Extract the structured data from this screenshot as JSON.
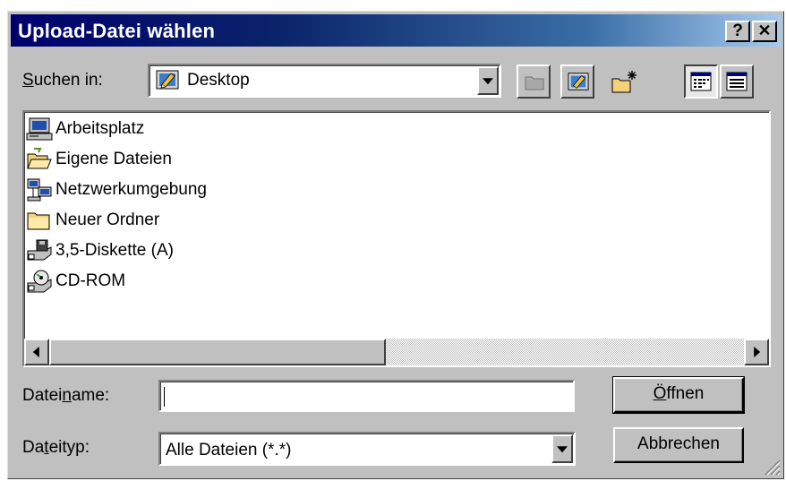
{
  "window": {
    "title": "Upload-Datei wählen",
    "help_glyph": "?",
    "close_glyph": "✕"
  },
  "lookin": {
    "label_pre": "",
    "label_u": "S",
    "label_post": "uchen in:",
    "value": "Desktop",
    "icon": "desktop-icon"
  },
  "toolbar": {
    "icons": [
      "up-one-level-icon",
      "desktop-icon",
      "new-folder-icon",
      "list-view-icon",
      "details-view-icon"
    ]
  },
  "files": [
    {
      "label": "Arbeitsplatz",
      "icon": "my-computer-icon"
    },
    {
      "label": "Eigene Dateien",
      "icon": "open-folder-icon"
    },
    {
      "label": "Netzwerkumgebung",
      "icon": "network-icon"
    },
    {
      "label": "Neuer Ordner",
      "icon": "folder-icon"
    },
    {
      "label": "3,5-Diskette (A)",
      "icon": "floppy-drive-icon"
    },
    {
      "label": "CD-ROM",
      "icon": "cd-drive-icon"
    }
  ],
  "filename": {
    "label_pre": "Datei",
    "label_u": "n",
    "label_post": "ame:",
    "value": ""
  },
  "filetype": {
    "label_pre": "Da",
    "label_u": "t",
    "label_post": "eityp:",
    "value": "Alle Dateien (*.*)"
  },
  "buttons": {
    "open_pre": "",
    "open_u": "Ö",
    "open_post": "ffnen",
    "cancel": "Abbrechen"
  },
  "colors": {
    "titlebar_start": "#00006e",
    "titlebar_end": "#a6caf0",
    "face": "#c0c0c0"
  }
}
